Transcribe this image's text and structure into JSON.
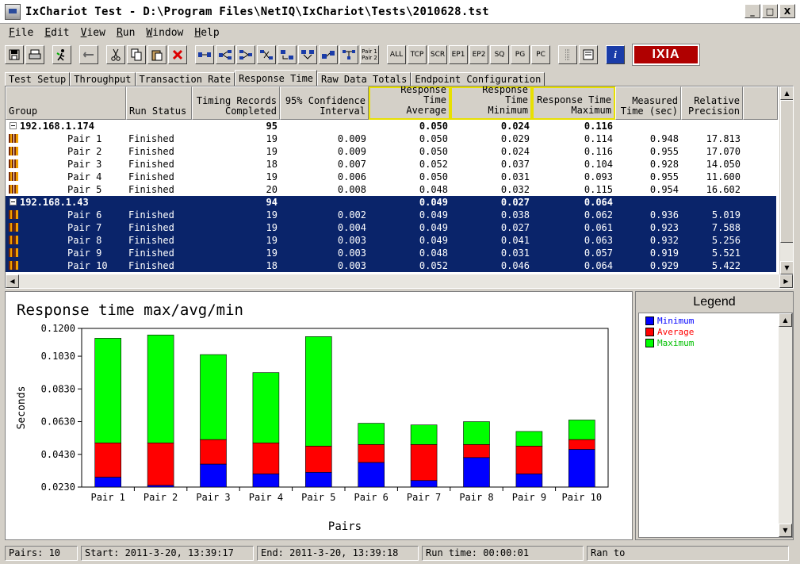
{
  "window": {
    "title": "IxChariot Test - D:\\Program Files\\NetIQ\\IxChariot\\Tests\\2010628.tst",
    "minimize": "_",
    "maximize": "□",
    "close": "X"
  },
  "menu": [
    {
      "label": "File",
      "key": "F",
      "rest": "ile"
    },
    {
      "label": "Edit",
      "key": "E",
      "rest": "dit"
    },
    {
      "label": "View",
      "key": "V",
      "rest": "iew"
    },
    {
      "label": "Run",
      "key": "R",
      "rest": "un"
    },
    {
      "label": "Window",
      "key": "W",
      "rest": "indow"
    },
    {
      "label": "Help",
      "key": "H",
      "rest": "elp"
    }
  ],
  "toolbar": {
    "text_buttons": [
      "ALL",
      "TCP",
      "SCR",
      "EP1",
      "EP2",
      "SQ",
      "PG",
      "PC"
    ],
    "pair_label_1": "Pair 1",
    "pair_label_2": "Pair 2",
    "brand": "IXIA",
    "info": "i"
  },
  "tabs": [
    "Test Setup",
    "Throughput",
    "Transaction Rate",
    "Response Time",
    "Raw Data Totals",
    "Endpoint Configuration"
  ],
  "active_tab": 3,
  "grid": {
    "headers": [
      [
        "",
        "Group"
      ],
      [
        "",
        "Run Status"
      ],
      [
        "Timing Records",
        "Completed"
      ],
      [
        "95% Confidence",
        "Interval"
      ],
      [
        "Response Time",
        "Average"
      ],
      [
        "Response Time",
        "Minimum"
      ],
      [
        "Response Time",
        "Maximum"
      ],
      [
        "Measured",
        "Time (sec)"
      ],
      [
        "Relative",
        "Precision"
      ]
    ],
    "rows": [
      {
        "type": "group",
        "name": "192.168.1.174",
        "status": "",
        "records": "95",
        "ci": "",
        "avg": "0.050",
        "min": "0.024",
        "max": "0.116",
        "time": "",
        "prec": "",
        "sel": false
      },
      {
        "type": "pair",
        "name": "Pair 1",
        "status": "Finished",
        "records": "19",
        "ci": "0.009",
        "avg": "0.050",
        "min": "0.029",
        "max": "0.114",
        "time": "0.948",
        "prec": "17.813",
        "sel": false
      },
      {
        "type": "pair",
        "name": "Pair 2",
        "status": "Finished",
        "records": "19",
        "ci": "0.009",
        "avg": "0.050",
        "min": "0.024",
        "max": "0.116",
        "time": "0.955",
        "prec": "17.070",
        "sel": false
      },
      {
        "type": "pair",
        "name": "Pair 3",
        "status": "Finished",
        "records": "18",
        "ci": "0.007",
        "avg": "0.052",
        "min": "0.037",
        "max": "0.104",
        "time": "0.928",
        "prec": "14.050",
        "sel": false
      },
      {
        "type": "pair",
        "name": "Pair 4",
        "status": "Finished",
        "records": "19",
        "ci": "0.006",
        "avg": "0.050",
        "min": "0.031",
        "max": "0.093",
        "time": "0.955",
        "prec": "11.600",
        "sel": false
      },
      {
        "type": "pair",
        "name": "Pair 5",
        "status": "Finished",
        "records": "20",
        "ci": "0.008",
        "avg": "0.048",
        "min": "0.032",
        "max": "0.115",
        "time": "0.954",
        "prec": "16.602",
        "sel": false
      },
      {
        "type": "group",
        "name": "192.168.1.43",
        "status": "",
        "records": "94",
        "ci": "",
        "avg": "0.049",
        "min": "0.027",
        "max": "0.064",
        "time": "",
        "prec": "",
        "sel": true
      },
      {
        "type": "pair",
        "name": "Pair 6",
        "status": "Finished",
        "records": "19",
        "ci": "0.002",
        "avg": "0.049",
        "min": "0.038",
        "max": "0.062",
        "time": "0.936",
        "prec": "5.019",
        "sel": true
      },
      {
        "type": "pair",
        "name": "Pair 7",
        "status": "Finished",
        "records": "19",
        "ci": "0.004",
        "avg": "0.049",
        "min": "0.027",
        "max": "0.061",
        "time": "0.923",
        "prec": "7.588",
        "sel": true
      },
      {
        "type": "pair",
        "name": "Pair 8",
        "status": "Finished",
        "records": "19",
        "ci": "0.003",
        "avg": "0.049",
        "min": "0.041",
        "max": "0.063",
        "time": "0.932",
        "prec": "5.256",
        "sel": true
      },
      {
        "type": "pair",
        "name": "Pair 9",
        "status": "Finished",
        "records": "19",
        "ci": "0.003",
        "avg": "0.048",
        "min": "0.031",
        "max": "0.057",
        "time": "0.919",
        "prec": "5.521",
        "sel": true
      },
      {
        "type": "pair",
        "name": "Pair 10",
        "status": "Finished",
        "records": "18",
        "ci": "0.003",
        "avg": "0.052",
        "min": "0.046",
        "max": "0.064",
        "time": "0.929",
        "prec": "5.422",
        "sel": true
      }
    ]
  },
  "colors": {
    "selection": "#0a246a",
    "minimum": "#0000ff",
    "average": "#ff0000",
    "maximum": "#00ff00",
    "highlight_border": "#e8e000"
  },
  "legend": {
    "title": "Legend",
    "items": [
      {
        "label": "Minimum",
        "color": "#0000ff"
      },
      {
        "label": "Average",
        "color": "#ff0000"
      },
      {
        "label": "Maximum",
        "color": "#00ff00"
      }
    ]
  },
  "chart_data": {
    "type": "bar",
    "title": "Response time max/avg/min",
    "xlabel": "Pairs",
    "ylabel": "Seconds",
    "ylim": [
      0.023,
      0.12
    ],
    "yticks": [
      "0.1200",
      "0.1030",
      "0.0830",
      "0.0630",
      "0.0430",
      "0.0230"
    ],
    "ytick_values": [
      0.12,
      0.103,
      0.083,
      0.063,
      0.043,
      0.023
    ],
    "categories": [
      "Pair 1",
      "Pair 2",
      "Pair 3",
      "Pair 4",
      "Pair 5",
      "Pair 6",
      "Pair 7",
      "Pair 8",
      "Pair 9",
      "Pair 10"
    ],
    "series": [
      {
        "name": "Minimum",
        "values": [
          0.029,
          0.024,
          0.037,
          0.031,
          0.032,
          0.038,
          0.027,
          0.041,
          0.031,
          0.046
        ]
      },
      {
        "name": "Average",
        "values": [
          0.05,
          0.05,
          0.052,
          0.05,
          0.048,
          0.049,
          0.049,
          0.049,
          0.048,
          0.052
        ]
      },
      {
        "name": "Maximum",
        "values": [
          0.114,
          0.116,
          0.104,
          0.093,
          0.115,
          0.062,
          0.061,
          0.063,
          0.057,
          0.064
        ]
      }
    ],
    "grid": false,
    "legend": "right-panel"
  },
  "status": {
    "pairs": "Pairs: 10",
    "start": "Start: 2011-3-20, 13:39:17",
    "end": "End: 2011-3-20, 13:39:18",
    "runtime": "Run time: 00:00:01",
    "ranto": "Ran to"
  }
}
